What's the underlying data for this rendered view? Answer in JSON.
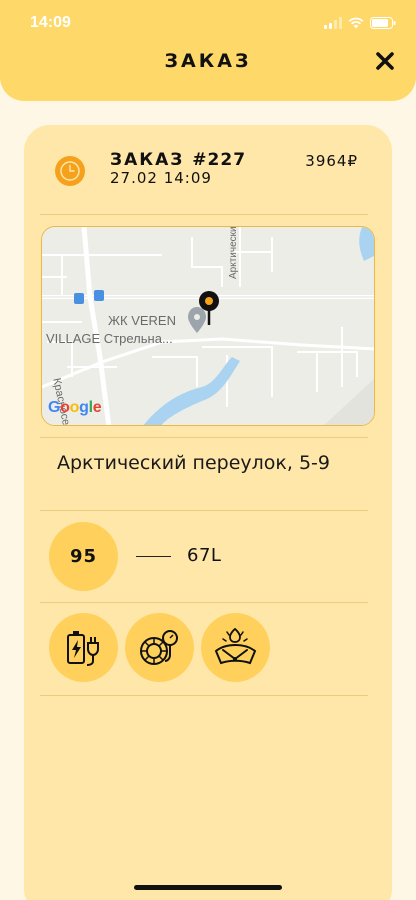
{
  "status_bar": {
    "time": "14:09"
  },
  "header": {
    "title": "ЗАКАЗ",
    "close_icon": "close-icon"
  },
  "order": {
    "title_prefix": "ЗАКАЗ",
    "number": "#227",
    "sum": "3964₽",
    "datetime": "27.02 14:09",
    "clock_icon": "clock-icon"
  },
  "map": {
    "poi_line1": "ЖК VEREN",
    "poi_line2": "VILLAGE Стрельна...",
    "street_vertical": "Красносельское",
    "street_arctic": "Арктический",
    "google": "Google",
    "colors": {
      "land": "#EDEDE8",
      "water": "#A9D3F0",
      "pin": "#F4A21C"
    }
  },
  "address": "Арктический переулок, 5-9",
  "fuel": {
    "type": "95",
    "volume": "67L"
  },
  "services": [
    {
      "name": "battery-charge-icon"
    },
    {
      "name": "tire-pressure-icon"
    },
    {
      "name": "windshield-washer-icon"
    }
  ],
  "colors": {
    "accent": "#FFD86A",
    "card": "#FFE7A9",
    "badge": "#FFD15C",
    "background": "#FEF7E6"
  }
}
